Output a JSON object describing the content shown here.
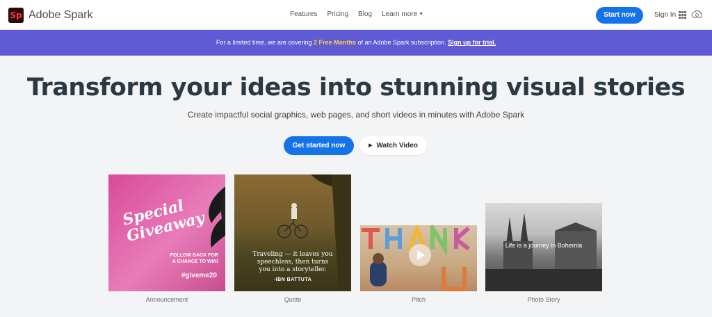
{
  "header": {
    "logo_mark": "Sp",
    "logo_text": "Adobe Spark",
    "nav": {
      "features": "Features",
      "pricing": "Pricing",
      "blog": "Blog",
      "learn_more": "Learn more"
    },
    "start_now": "Start now",
    "sign_in": "Sign In",
    "icons": [
      "apps-grid-icon",
      "creative-cloud-icon"
    ]
  },
  "banner": {
    "text_before": "For a limited time, we are covering ",
    "highlight": "2 Free Months",
    "text_after": " of an Adobe Spark subscription. ",
    "link": "Sign up for trial."
  },
  "hero": {
    "title": "Transform your ideas into stunning visual stories",
    "subtitle": "Create impactful social graphics, web pages, and short videos in minutes with Adobe Spark",
    "get_started": "Get started now",
    "watch_video": "Watch Video"
  },
  "cards": {
    "announcement": {
      "label": "Announcement",
      "line1": "Special",
      "line2": "Giveaway",
      "small1": "FOLLOW BACK FOR",
      "small2": "A CHANCE TO WIN!",
      "tag": "#giveme20"
    },
    "quote": {
      "label": "Quote",
      "line1": "Traveling — it leaves you",
      "line2": "speechless, then turns",
      "line3": "you into a storyteller.",
      "author": "-IBN BATTUTA"
    },
    "pitch": {
      "label": "Pitch"
    },
    "photo_story": {
      "label": "Photo Story",
      "title": "Life is a journey in Bohemia"
    }
  },
  "colors": {
    "accent": "#1473e6",
    "banner": "#5f5bd4",
    "banner_highlight": "#ffd24a",
    "logo_bg": "#2b0a0a",
    "logo_fg": "#ff3b30",
    "background": "#f3f4f6"
  }
}
